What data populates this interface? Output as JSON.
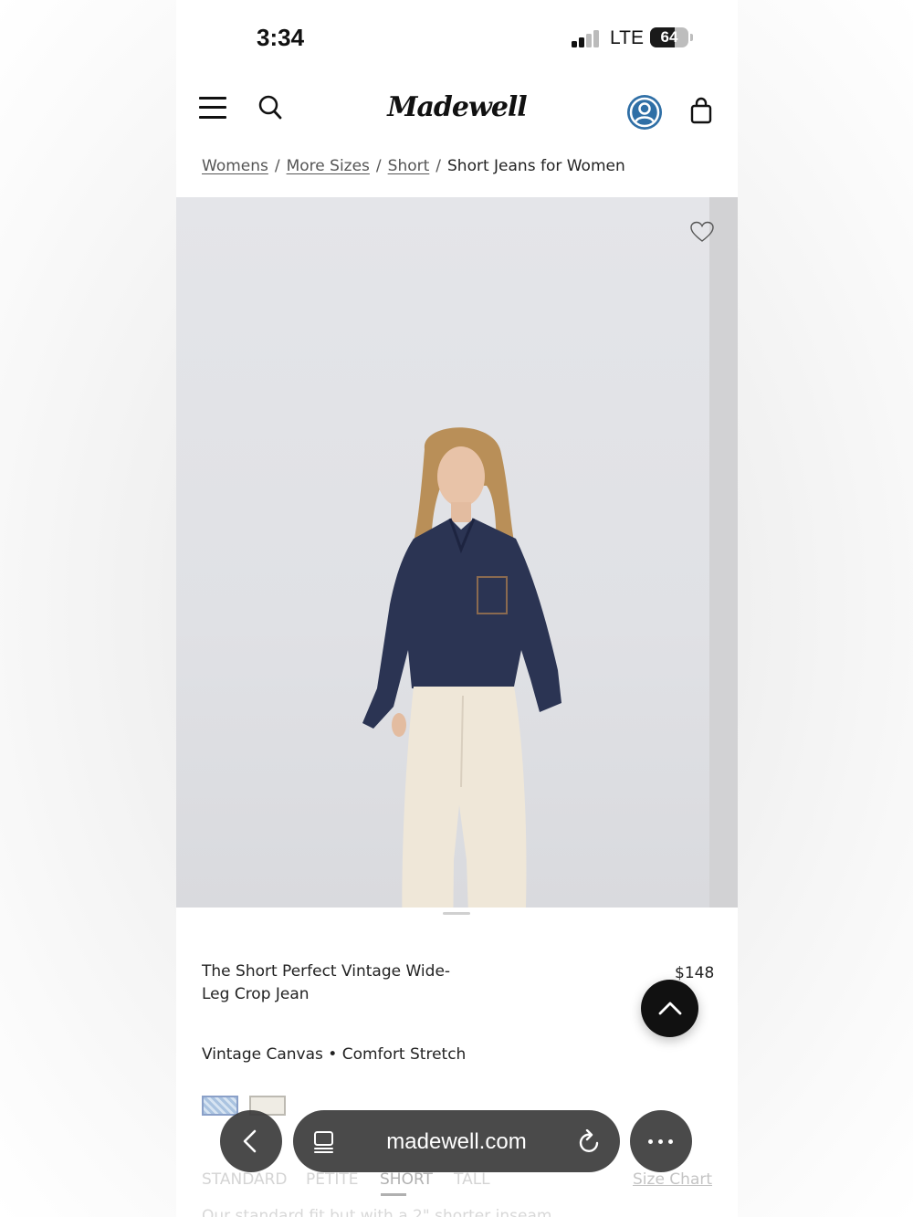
{
  "status_bar": {
    "time": "3:34",
    "network": "LTE",
    "battery": "64",
    "battery_level": 0.64
  },
  "header": {
    "logo": "Madewell",
    "menu_icon": "hamburger-icon",
    "search_icon": "search-icon",
    "account_icon": "account-icon",
    "bag_icon": "shopping-bag-icon",
    "account_color": "#2f6fa6"
  },
  "breadcrumb": {
    "items": [
      "Womens",
      "More Sizes",
      "Short"
    ],
    "current": "Short Jeans for Women",
    "separator": "/"
  },
  "product": {
    "name": "The Short Perfect Vintage Wide-Leg Crop Jean",
    "price": "$148",
    "fabric": "Vintage Canvas • Comfort Stretch",
    "swatches": [
      "light-blue-print",
      "vintage-canvas"
    ]
  },
  "size_tabs": {
    "items": [
      "STANDARD",
      "PETITE",
      "SHORT",
      "TALL"
    ],
    "selected": "SHORT",
    "size_chart": "Size Chart"
  },
  "fit_note": "Our standard fit but with a 2\" shorter inseam",
  "browser": {
    "url": "madewell.com"
  }
}
